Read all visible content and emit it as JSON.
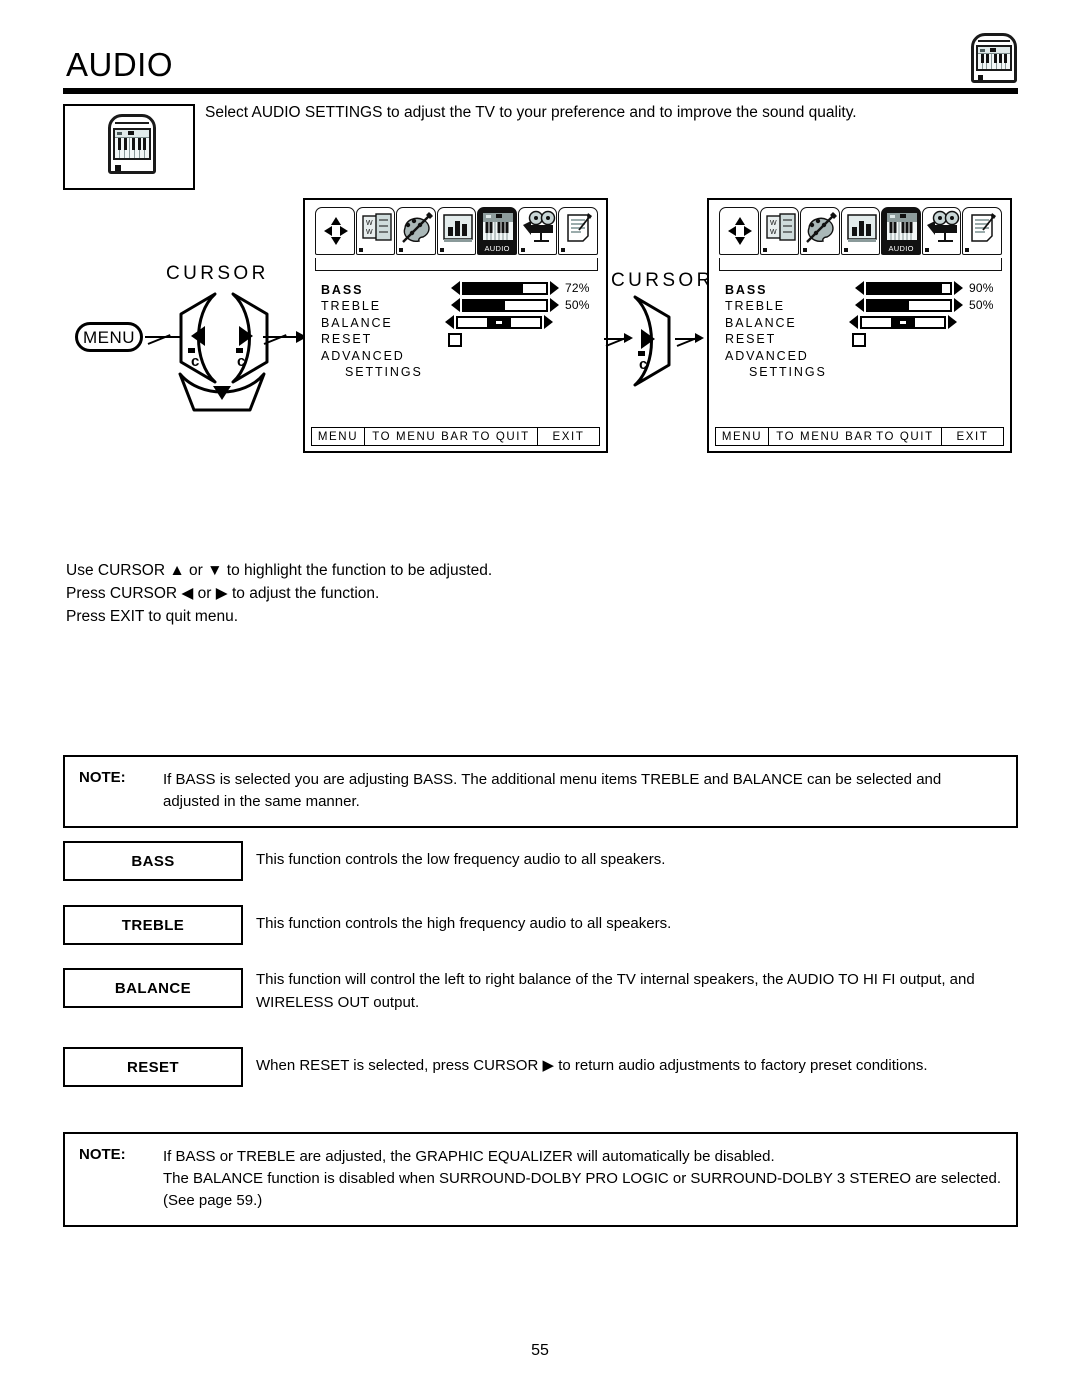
{
  "page": {
    "title": "AUDIO",
    "number": "55",
    "intro": "Select AUDIO SETTINGS to adjust the TV to your preference and to improve the sound quality.",
    "header_icon": "piano-keyboard-icon",
    "corner_icon": "piano-keyboard-icon"
  },
  "remote": {
    "cursor_label": "CURSOR",
    "menu_button": "MENU",
    "keys": {
      "left": "cursor-left-key",
      "right": "cursor-right-key",
      "down": "cursor-down-key"
    }
  },
  "remote2": {
    "cursor_label": "CURSOR",
    "keys": {
      "right": "cursor-right-key"
    }
  },
  "osd": {
    "icon_bar": [
      {
        "name": "cursor-pad-icon",
        "selected": false,
        "tag": ""
      },
      {
        "name": "channel-setup-icon",
        "selected": false,
        "tag": ""
      },
      {
        "name": "picture-palette-icon",
        "selected": false,
        "tag": ""
      },
      {
        "name": "levels-bars-icon",
        "selected": false,
        "tag": ""
      },
      {
        "name": "audio-piano-icon",
        "selected": true,
        "tag": "AUDIO"
      },
      {
        "name": "video-projector-icon",
        "selected": false,
        "tag": ""
      },
      {
        "name": "setup-document-icon",
        "selected": false,
        "tag": ""
      }
    ],
    "items": [
      {
        "label": "BASS",
        "selected": true,
        "indent": false
      },
      {
        "label": "TREBLE",
        "selected": false,
        "indent": false
      },
      {
        "label": "BALANCE",
        "selected": false,
        "indent": false
      },
      {
        "label": "RESET",
        "selected": false,
        "indent": false
      },
      {
        "label": "ADVANCED",
        "selected": false,
        "indent": false
      },
      {
        "label": "SETTINGS",
        "selected": false,
        "indent": true
      }
    ],
    "footer": {
      "menu": "MENU",
      "to_menu_bar": "TO MENU BAR",
      "to_quit": "TO QUIT",
      "exit": "EXIT"
    }
  },
  "osd_before": {
    "bass_value": "72%",
    "bass_percent": 72,
    "treble_value": "50%",
    "treble_percent": 50,
    "balance_percent": 50
  },
  "osd_after": {
    "bass_value": "90%",
    "bass_percent": 90,
    "treble_value": "50%",
    "treble_percent": 50,
    "balance_percent": 50
  },
  "instructions": {
    "line1_a": "Use CURSOR ",
    "line1_up": "▲",
    "line1_b": " or ",
    "line1_down": "▼",
    "line1_c": " to highlight the function to be adjusted.",
    "line2_a": "Press CURSOR ",
    "line2_left": "◀",
    "line2_b": " or ",
    "line2_right": "▶",
    "line2_c": " to adjust the function.",
    "line3": "Press EXIT to quit menu."
  },
  "note_top": {
    "label": "NOTE:",
    "text": "If BASS is selected you are adjusting BASS.  The additional menu items TREBLE and BALANCE can be selected and adjusted in the same manner."
  },
  "functions": [
    {
      "key": "BASS",
      "desc": "This function controls the low frequency audio to all speakers."
    },
    {
      "key": "TREBLE",
      "desc": "This function controls the high frequency audio to all speakers."
    },
    {
      "key": "BALANCE",
      "desc": "This function will control the left to right balance of the TV internal speakers, the AUDIO TO HI FI output, and WIRELESS OUT output."
    },
    {
      "key": "RESET",
      "desc_a": "When RESET is selected, press CURSOR ",
      "desc_arrow": "▶",
      "desc_b": " to return audio adjustments to factory preset conditions."
    }
  ],
  "note_bottom": {
    "label": "NOTE:",
    "line1": "If BASS or TREBLE are adjusted, the GRAPHIC EQUALIZER will automatically be disabled.",
    "line2": "The BALANCE function is disabled when SURROUND-DOLBY PRO LOGIC or SURROUND-DOLBY 3 STEREO are selected. (See page 59.)"
  },
  "colors": {
    "ink": "#000000",
    "panel": "#cfdcdc",
    "key_white": "#f2f7f7"
  }
}
